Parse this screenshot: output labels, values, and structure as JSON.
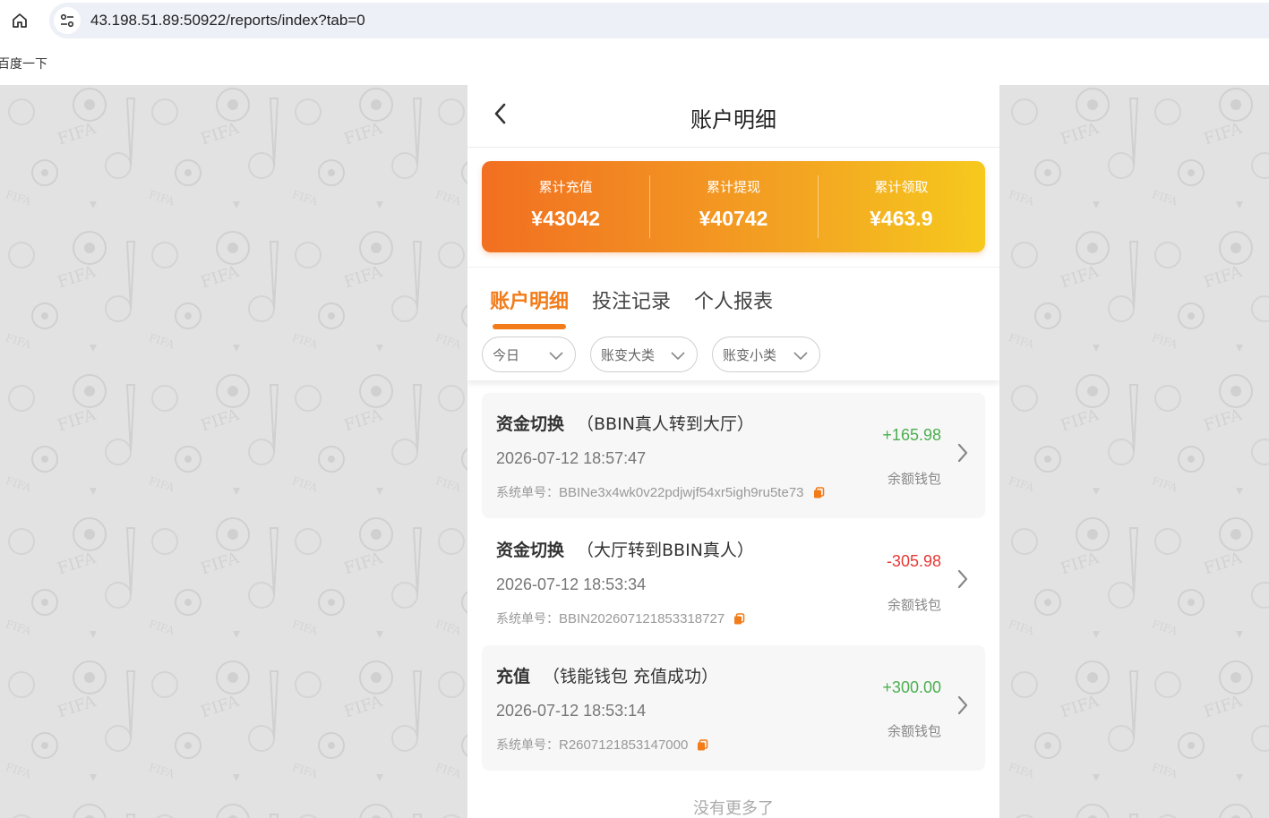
{
  "browser": {
    "url": "43.198.51.89:50922/reports/index?tab=0",
    "bookmark": "百度一下",
    "home_icon": "home-icon",
    "site_icon": "tune-icon"
  },
  "header": {
    "title": "账户明细",
    "back_icon": "chevron-left-icon"
  },
  "summary": [
    {
      "label": "累计充值",
      "value": "¥43042"
    },
    {
      "label": "累计提现",
      "value": "¥40742"
    },
    {
      "label": "累计领取",
      "value": "¥463.9"
    }
  ],
  "tabs": [
    {
      "label": "账户明细",
      "active": true
    },
    {
      "label": "投注记录",
      "active": false
    },
    {
      "label": "个人报表",
      "active": false
    }
  ],
  "filters": [
    {
      "value": "今日"
    },
    {
      "value": "账变大类"
    },
    {
      "value": "账变小类"
    }
  ],
  "records": [
    {
      "type": "资金切换",
      "detail": "（BBIN真人转到大厅）",
      "time": "2026-07-12 18:57:47",
      "order_label": "系统单号：",
      "order_no": "BBINe3x4wk0v22pdjwjf54xr5igh9ru5te73",
      "amount": "+165.98",
      "wallet": "余额钱包"
    },
    {
      "type": "资金切换",
      "detail": "（大厅转到BBIN真人）",
      "time": "2026-07-12 18:53:34",
      "order_label": "系统单号：",
      "order_no": "BBIN202607121853318727",
      "amount": "-305.98",
      "wallet": "余额钱包"
    },
    {
      "type": "充值",
      "detail": "（钱能钱包 充值成功）",
      "time": "2026-07-12 18:53:14",
      "order_label": "系统单号：",
      "order_no": "R2607121853147000",
      "amount": "+300.00",
      "wallet": "余额钱包"
    }
  ],
  "footer": {
    "no_more": "没有更多了"
  },
  "colors": {
    "accent": "#f27c1a",
    "positive": "#4caf50",
    "negative": "#e53935",
    "gradient_start": "#f26f21",
    "gradient_end": "#f6c91d"
  }
}
